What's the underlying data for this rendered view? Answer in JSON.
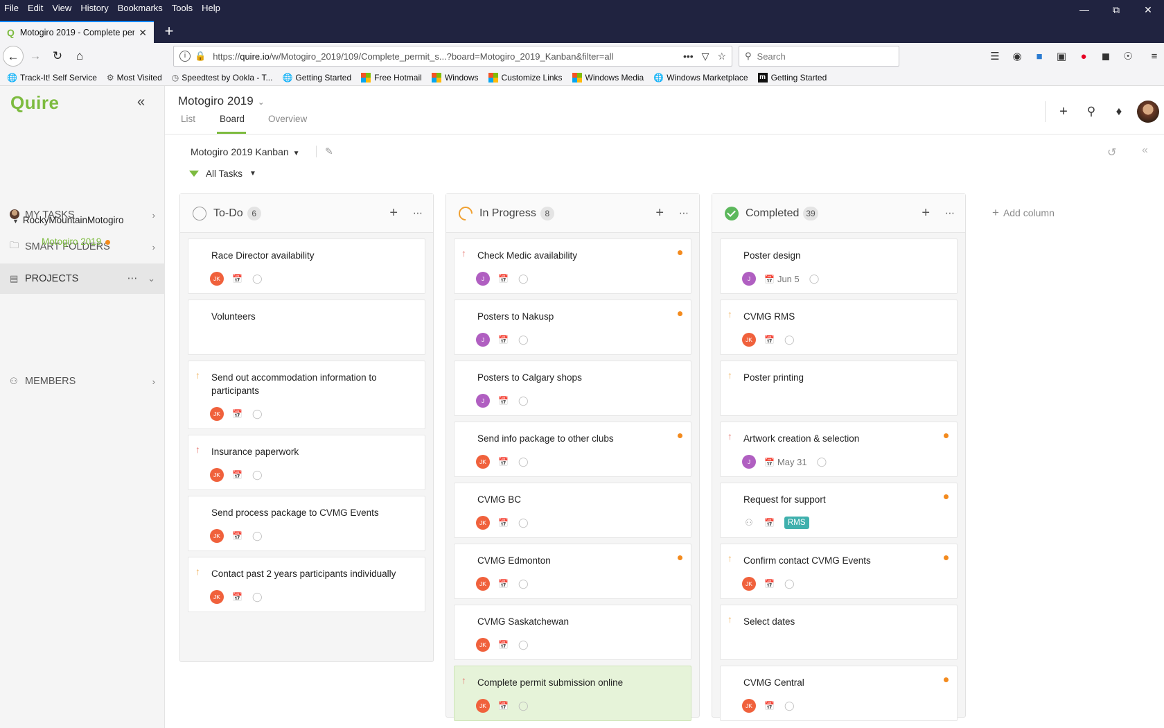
{
  "browser": {
    "menu": [
      "File",
      "Edit",
      "View",
      "History",
      "Bookmarks",
      "Tools",
      "Help"
    ],
    "tab_title": "Motogiro 2019 - Complete per",
    "url_prefix": "https://",
    "url_host": "quire.io",
    "url_path": "/w/Motogiro_2019/109/Complete_permit_s...?board=Motogiro_2019_Kanban&filter=all",
    "search_placeholder": "Search",
    "bookmarks": [
      "Track-It! Self Service",
      "Most Visited",
      "Speedtest by Ookla - T...",
      "Getting Started",
      "Free Hotmail",
      "Windows",
      "Customize Links",
      "Windows Media",
      "Windows Marketplace",
      "Getting Started"
    ]
  },
  "sidebar": {
    "logo": "Quire",
    "my_tasks": "MY TASKS",
    "smart_folders": "SMART FOLDERS",
    "projects": "PROJECTS",
    "tree_parent": "RockyMountainMotogiro",
    "tree_child": "Motogiro 2019",
    "members": "MEMBERS"
  },
  "header": {
    "project_title": "Motogiro 2019",
    "tabs": [
      "List",
      "Board",
      "Overview"
    ],
    "board_name": "Motogiro 2019 Kanban",
    "filter": "All Tasks"
  },
  "columns": [
    {
      "title": "To-Do",
      "count": "6",
      "cards": [
        {
          "title": "Race Director availability",
          "assignee": "JK"
        },
        {
          "title": "Volunteers",
          "assignee": ""
        },
        {
          "title": "Send out accommodation information to participants",
          "assignee": "JK"
        },
        {
          "title": "Insurance paperwork",
          "assignee": "JK"
        },
        {
          "title": "Send process package to CVMG Events",
          "assignee": "JK"
        },
        {
          "title": "Contact past 2 years participants individually",
          "assignee": "JK"
        }
      ]
    },
    {
      "title": "In Progress",
      "count": "8",
      "cards": [
        {
          "title": "Check Medic availability",
          "assignee": "J"
        },
        {
          "title": "Posters to Nakusp",
          "assignee": "J"
        },
        {
          "title": "Posters to Calgary shops",
          "assignee": "J"
        },
        {
          "title": "Send info package to other clubs",
          "assignee": "JK"
        },
        {
          "title": "CVMG BC",
          "assignee": "JK"
        },
        {
          "title": "CVMG Edmonton",
          "assignee": "JK"
        },
        {
          "title": "CVMG Saskatchewan",
          "assignee": "JK"
        },
        {
          "title": "Complete permit submission online",
          "assignee": "JK"
        }
      ]
    },
    {
      "title": "Completed",
      "count": "39",
      "cards": [
        {
          "title": "Poster design",
          "assignee": "J",
          "date": "Jun 5"
        },
        {
          "title": "CVMG RMS",
          "assignee": "JK"
        },
        {
          "title": "Poster printing",
          "assignee": ""
        },
        {
          "title": "Artwork creation & selection",
          "assignee": "J",
          "date": "May 31"
        },
        {
          "title": "Request for support",
          "assignee": "",
          "tag": "RMS"
        },
        {
          "title": "Confirm contact CVMG Events",
          "assignee": "JK"
        },
        {
          "title": "Select dates",
          "assignee": ""
        },
        {
          "title": "CVMG Central",
          "assignee": "JK"
        }
      ]
    }
  ],
  "add_column": "Add column"
}
